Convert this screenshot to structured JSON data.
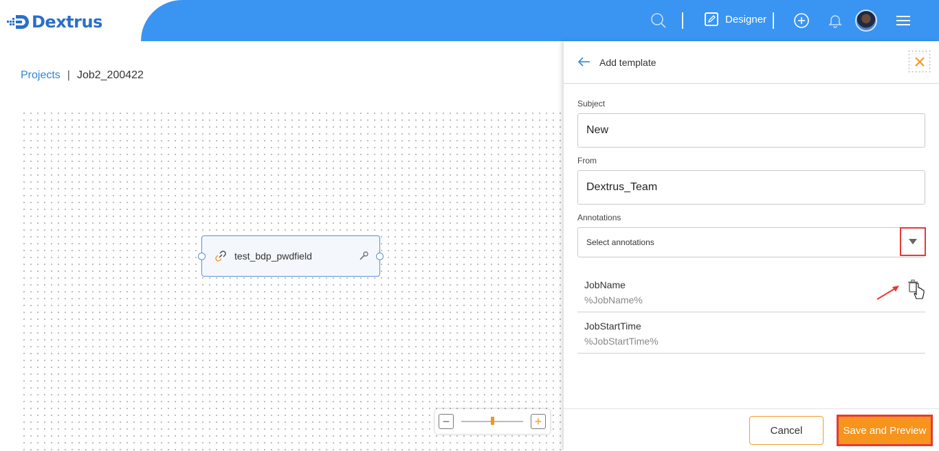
{
  "app": {
    "name": "Dextrus"
  },
  "header": {
    "mode_label": "Designer",
    "icons": [
      "search-icon",
      "designer-edit-icon",
      "add-circle-icon",
      "bell-icon",
      "avatar",
      "hamburger-menu-icon"
    ]
  },
  "breadcrumb": {
    "root": "Projects",
    "separator": "|",
    "current": "Job2_200422"
  },
  "canvas": {
    "node": {
      "label": "test_bdp_pwdfield",
      "icon": "link-icon",
      "action_icon": "wrench-icon"
    },
    "zoom": {
      "minus": "−",
      "plus": "+",
      "level": 0.5
    }
  },
  "panel": {
    "title": "Add template",
    "subject": {
      "label": "Subject",
      "value": "New"
    },
    "from": {
      "label": "From",
      "value": "Dextrus_Team"
    },
    "annotations": {
      "label": "Annotations",
      "placeholder": "Select annotations",
      "items": [
        {
          "name": "JobName",
          "value": "%JobName%"
        },
        {
          "name": "JobStartTime",
          "value": "%JobStartTime%"
        }
      ]
    },
    "cancel_label": "Cancel",
    "save_label": "Save and Preview"
  },
  "colors": {
    "header_blue": "#3a95f2",
    "accent_orange": "#f7941d",
    "highlight_red": "#e53935",
    "link_blue": "#2f86d8"
  }
}
